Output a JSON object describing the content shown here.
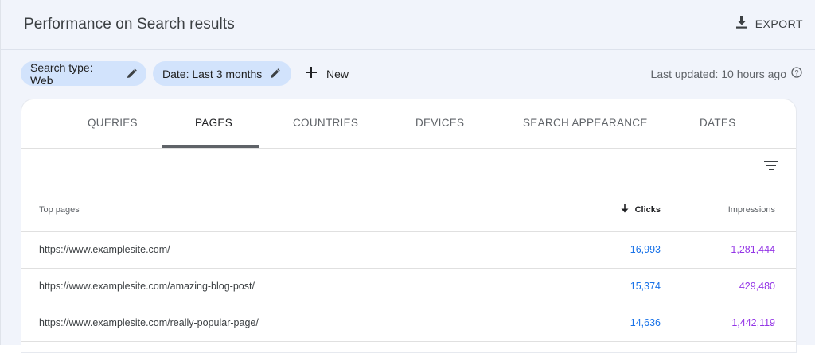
{
  "header": {
    "title": "Performance on Search results",
    "export_label": "EXPORT"
  },
  "filters": {
    "chips": [
      {
        "label": "Search type: Web"
      },
      {
        "label": "Date: Last 3 months"
      }
    ],
    "new_label": "New",
    "last_updated": "Last updated: 10 hours ago"
  },
  "tabs": [
    {
      "label": "QUERIES"
    },
    {
      "label": "PAGES"
    },
    {
      "label": "COUNTRIES"
    },
    {
      "label": "DEVICES"
    },
    {
      "label": "SEARCH APPEARANCE"
    },
    {
      "label": "DATES"
    }
  ],
  "active_tab": "PAGES",
  "table": {
    "columns": {
      "page": "Top pages",
      "clicks": "Clicks",
      "impressions": "Impressions"
    },
    "rows": [
      {
        "url": "https://www.examplesite.com/",
        "clicks": "16,993",
        "impressions": "1,281,444"
      },
      {
        "url": "https://www.examplesite.com/amazing-blog-post/",
        "clicks": "15,374",
        "impressions": "429,480"
      },
      {
        "url": "https://www.examplesite.com/really-popular-page/",
        "clicks": "14,636",
        "impressions": "1,442,119"
      }
    ]
  },
  "colors": {
    "chip_bg": "#d2e3fc",
    "clicks": "#1a73e8",
    "impressions": "#9334e6"
  },
  "icons": [
    "download-icon",
    "pencil-icon",
    "plus-icon",
    "help-icon",
    "filter-icon",
    "arrow-down-icon"
  ]
}
